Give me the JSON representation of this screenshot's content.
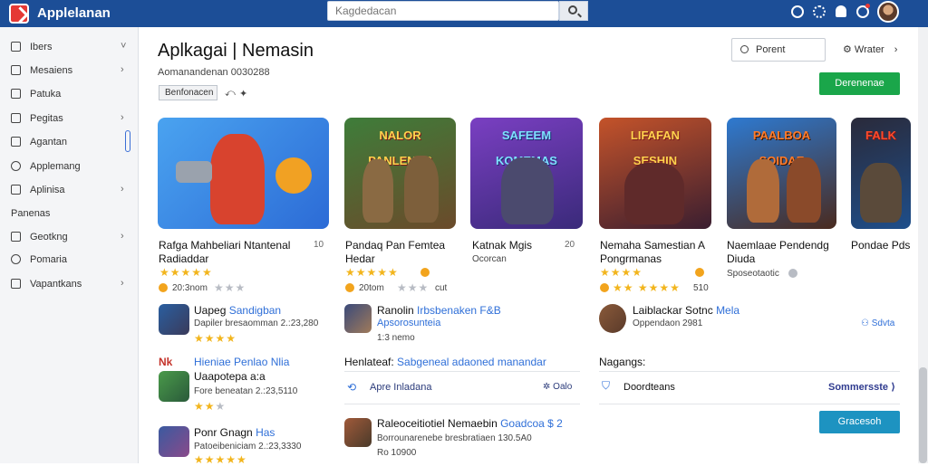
{
  "app": {
    "title": "Applelanan"
  },
  "search": {
    "placeholder": "Kagdedacan"
  },
  "sidebar": {
    "items": [
      {
        "label": "Ibers",
        "chevron": "˅"
      },
      {
        "label": "Mesaiens",
        "chevron": "›"
      },
      {
        "label": "Patuka",
        "chevron": ""
      },
      {
        "label": "Pegitas",
        "chevron": "›"
      },
      {
        "label": "Agantan",
        "chevron": ""
      },
      {
        "label": "Applemang",
        "chevron": ""
      },
      {
        "label": "Aplinisa",
        "chevron": "›"
      }
    ],
    "section": "Panenas",
    "items2": [
      {
        "label": "Geotkng",
        "chevron": "›"
      },
      {
        "label": "Pomaria",
        "chevron": ""
      },
      {
        "label": "Vapantkans",
        "chevron": "›"
      }
    ]
  },
  "header": {
    "title": "Aplkagai | Nemasin",
    "subtitle": "Aomanandenan 0030288",
    "tag": "Benfonacen",
    "filter_label": "Porent",
    "view_label": "Wrater",
    "view_chevron": "›",
    "primary_button": "Derenenae"
  },
  "cards": [
    {
      "title": "Rafga Mahbeliari Ntantenal Radiaddar",
      "price": "10",
      "rating_text": "20:3nom",
      "banner": ""
    },
    {
      "title": "Pandaq Pan Femtea Hedar",
      "price": "",
      "rating_text": "20tom",
      "rating_extra": "cut",
      "banner": "NALOR PANLENAS"
    },
    {
      "title": "Katnak Mgis",
      "price": "20",
      "rating_text": "Ocorcan",
      "banner": "SAFEEM KOMEMAS"
    },
    {
      "title": "Nemaha Samestian A Pongrmanas",
      "price": "",
      "rating_text": "",
      "rating_extra": "510",
      "banner": "LIFAFAN SESHIN"
    },
    {
      "title": "Naemlaae Pendendg Diuda",
      "price": "",
      "rating_text": "Sposeotaotic",
      "banner": "PAALBOA SOIDAE"
    },
    {
      "title": "Pondae Pds",
      "price": "",
      "rating_text": "",
      "banner": "FALK"
    }
  ],
  "list_left": [
    {
      "title": "Uapeg",
      "link": "Sandigban",
      "meta": "Dapiler bresaomman  2.:23,280"
    },
    {
      "title": "Hieniae Penlao Nlia",
      "link": "",
      "subtitle": "Uaapotepa a:a",
      "meta": "Fore beneatan  2.:23,5110"
    },
    {
      "title": "Ponr Gnagn",
      "link": "Has",
      "meta": "Patoeibeniciam  2.:23,3330"
    }
  ],
  "list_mid": [
    {
      "title": "Ranolin",
      "link": "Irbsbenaken F&B",
      "subtitle": "Apsorosunteia",
      "meta": "1:3 nemo"
    },
    {
      "title": "Henlateaf:",
      "link": "Sabgeneal adaoned manandar",
      "meta": ""
    },
    {
      "title": "Apre Inladana",
      "right": "Oalo",
      "meta": ""
    },
    {
      "title": "Raleoceitiotiel Nemaebin",
      "link": "Goadcoa $ 2",
      "meta": "Borrounarenebe bresbratiaen  130.5A0",
      "meta2": "Ro 10900"
    }
  ],
  "list_right": [
    {
      "title": "Laiblackar Sotnc",
      "link": "Mela",
      "meta": "Oppendaon 2981",
      "right": "Sdvta"
    },
    {
      "title": "Nagangs:",
      "meta": ""
    },
    {
      "title": "Doordteans",
      "link": "Sommersste",
      "meta": ""
    }
  ],
  "secondary_button": "Gracesoh",
  "colors": {
    "topbar": "#1c4e97",
    "accent_green": "#1aa64a",
    "accent_teal": "#1d93c1",
    "star": "#f2b51d",
    "link": "#2f6fd8"
  }
}
